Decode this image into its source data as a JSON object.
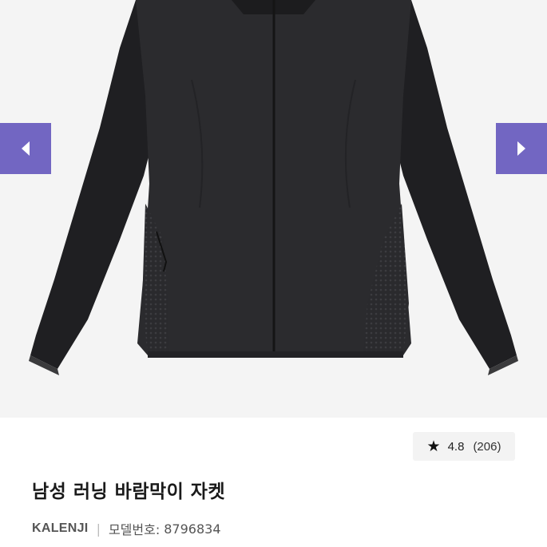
{
  "gallery": {
    "image_alt": "Black men's running windbreaker jacket",
    "prev_icon": "chevron-left-icon",
    "next_icon": "chevron-right-icon",
    "nav_color": "#7266c2"
  },
  "rating": {
    "star_icon": "star-icon",
    "score": "4.8",
    "count": "(206)"
  },
  "product": {
    "title": "남성 러닝 바람막이 자켓",
    "brand": "KALENJI",
    "separator": "|",
    "model_label": "모델번호:",
    "model_number": "8796834"
  }
}
